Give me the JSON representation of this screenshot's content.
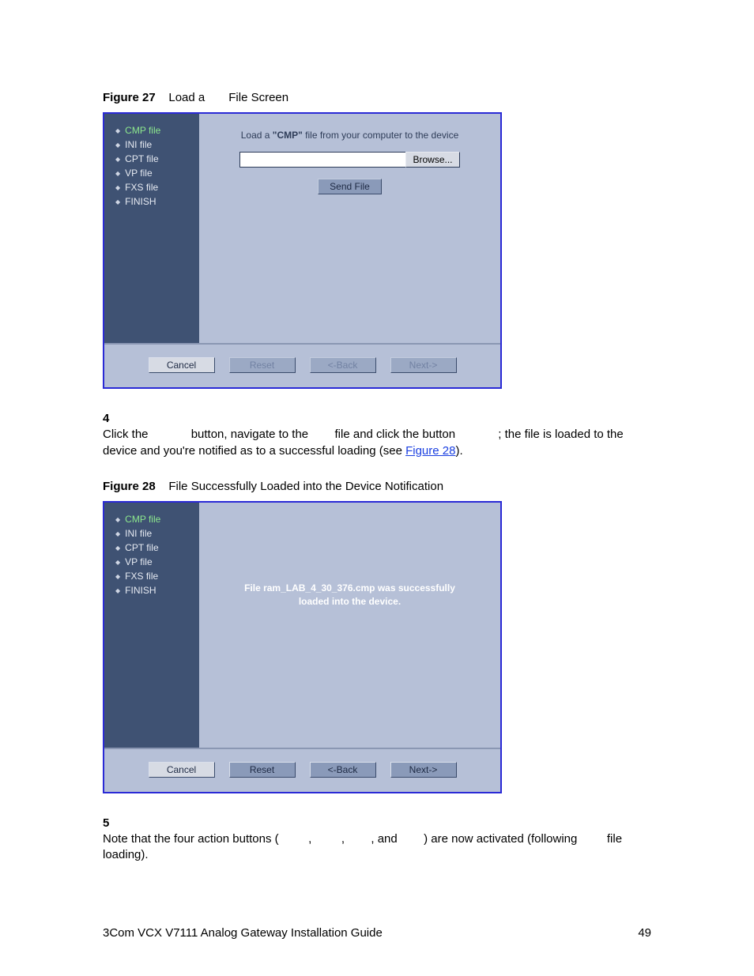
{
  "figure27": {
    "label": "Figure 27",
    "title_a": "Load a",
    "title_b": "File Screen"
  },
  "screenshot1": {
    "sidebar": [
      "CMP file",
      "INI file",
      "CPT file",
      "VP file",
      "FXS file",
      "FINISH"
    ],
    "active_index": 0,
    "prompt_pre": "Load a ",
    "prompt_bold": "\"CMP\"",
    "prompt_post": " file from your computer to the device",
    "browse": "Browse...",
    "send": "Send File",
    "buttons": {
      "cancel": "Cancel",
      "reset": "Reset",
      "back": "<-Back",
      "next": "Next->"
    },
    "buttons_enabled": {
      "cancel": true,
      "reset": false,
      "back": false,
      "next": false
    }
  },
  "step4": {
    "num": "4",
    "a": "Click the ",
    "b": " button, navigate to the ",
    "c": " file and click the button ",
    "d": "; the file is loaded to the device and you're notified as to a successful loading (see ",
    "link": "Figure 28",
    "e": ")."
  },
  "figure28": {
    "label": "Figure 28",
    "title": "File Successfully Loaded into the Device Notification"
  },
  "screenshot2": {
    "sidebar": [
      "CMP file",
      "INI file",
      "CPT file",
      "VP file",
      "FXS file",
      "FINISH"
    ],
    "active_index": 0,
    "success_l1": "File ram_LAB_4_30_376.cmp was successfully",
    "success_l2": "loaded into the device.",
    "buttons": {
      "cancel": "Cancel",
      "reset": "Reset",
      "back": "<-Back",
      "next": "Next->"
    },
    "buttons_enabled": {
      "cancel": true,
      "reset": true,
      "back": true,
      "next": true
    }
  },
  "step5": {
    "num": "5",
    "a": "Note that the four action buttons (",
    "b": ", ",
    "c": ", ",
    "d": ", and ",
    "e": ") are now activated (following ",
    "f": " file loading)."
  },
  "footer": {
    "title": "3Com VCX V7111 Analog Gateway Installation Guide",
    "page": "49"
  }
}
